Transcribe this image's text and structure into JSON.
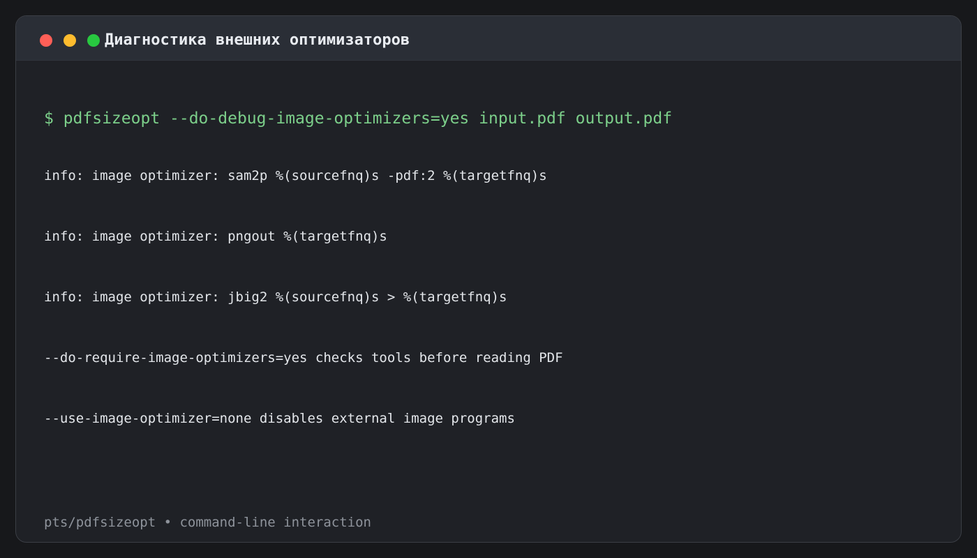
{
  "window": {
    "title": "Диагностика внешних оптимизаторов",
    "controls": [
      "close",
      "minimize",
      "maximize"
    ],
    "control_colors": {
      "close": "#ff5f57",
      "minimize": "#febc2e",
      "maximize": "#28c840"
    }
  },
  "terminal": {
    "command": "$ pdfsizeopt --do-debug-image-optimizers=yes input.pdf output.pdf",
    "output": [
      "info: image optimizer: sam2p %(sourcefnq)s -pdf:2 %(targetfnq)s",
      "info: image optimizer: pngout %(targetfnq)s",
      "info: image optimizer: jbig2 %(sourcefnq)s > %(targetfnq)s",
      "--do-require-image-optimizers=yes checks tools before reading PDF",
      "--use-image-optimizer=none disables external image programs"
    ],
    "command_color": "#7ccf8a"
  },
  "footer": {
    "text": "pts/pdfsizeopt • command-line interaction"
  }
}
